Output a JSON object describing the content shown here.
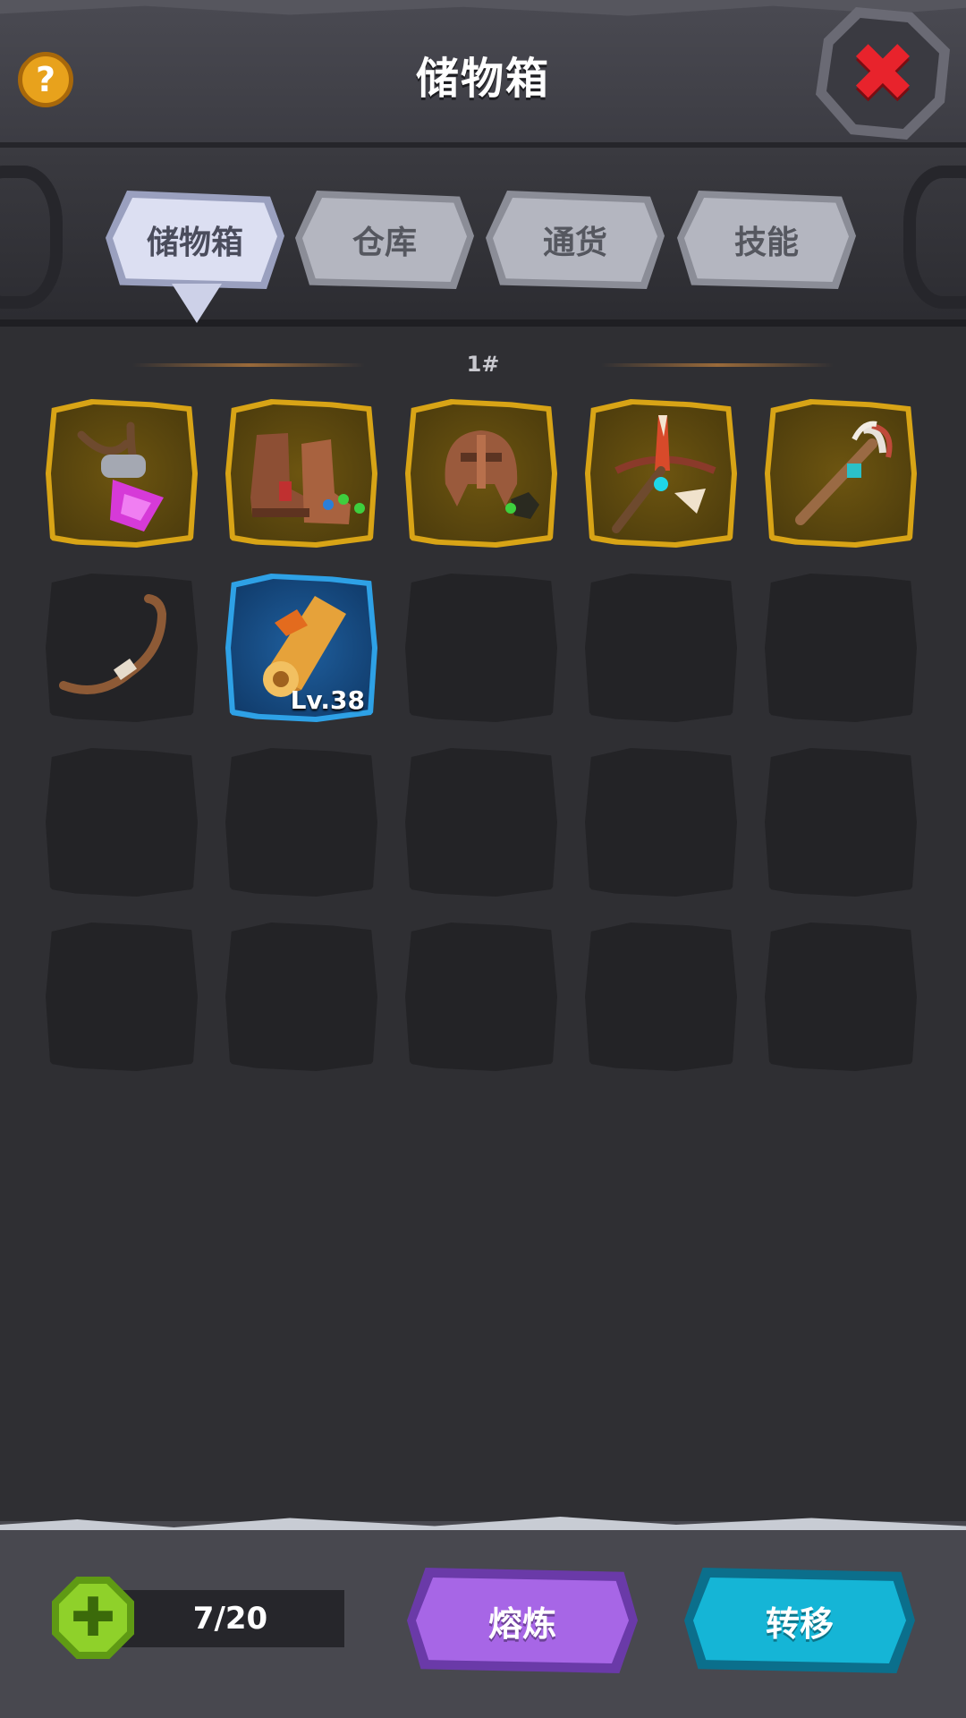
{
  "header": {
    "title": "储物箱",
    "help_icon": "question-mark-icon",
    "help_glyph": "?",
    "close_icon": "close-x-icon",
    "close_glyph": "✖"
  },
  "tabs": [
    {
      "label": "储物箱",
      "active": true
    },
    {
      "label": "仓库",
      "active": false
    },
    {
      "label": "通货",
      "active": false
    },
    {
      "label": "技能",
      "active": false
    }
  ],
  "page_indicator": "1#",
  "inventory": {
    "slots": [
      {
        "item": "amulet-icon",
        "rarity": "gold"
      },
      {
        "item": "boots-icon",
        "rarity": "gold"
      },
      {
        "item": "helmet-icon",
        "rarity": "gold"
      },
      {
        "item": "crossbow-icon",
        "rarity": "gold"
      },
      {
        "item": "staff-icon",
        "rarity": "gold"
      },
      {
        "item": "bow-icon",
        "rarity": "none"
      },
      {
        "item": "scroll-icon",
        "rarity": "blue",
        "level": "Lv.38"
      },
      {
        "item": "",
        "rarity": "empty"
      },
      {
        "item": "",
        "rarity": "empty"
      },
      {
        "item": "",
        "rarity": "empty"
      },
      {
        "item": "",
        "rarity": "empty"
      },
      {
        "item": "",
        "rarity": "empty"
      },
      {
        "item": "",
        "rarity": "empty"
      },
      {
        "item": "",
        "rarity": "empty"
      },
      {
        "item": "",
        "rarity": "empty"
      },
      {
        "item": "",
        "rarity": "empty"
      },
      {
        "item": "",
        "rarity": "empty"
      },
      {
        "item": "",
        "rarity": "empty"
      },
      {
        "item": "",
        "rarity": "empty"
      },
      {
        "item": "",
        "rarity": "empty"
      }
    ]
  },
  "footer": {
    "expand_icon": "plus-cross-icon",
    "expand_glyph": "✚",
    "capacity": "7/20",
    "smelt_label": "熔炼",
    "transfer_label": "转移"
  },
  "colors": {
    "background": "#2f2f33",
    "gold_frame": "#d8a416",
    "blue_frame": "#2ea1e6",
    "close_red": "#e8232c",
    "smelt_purple": "#a766e6",
    "transfer_cyan": "#15b5d6",
    "expand_green": "#8fd12a"
  }
}
